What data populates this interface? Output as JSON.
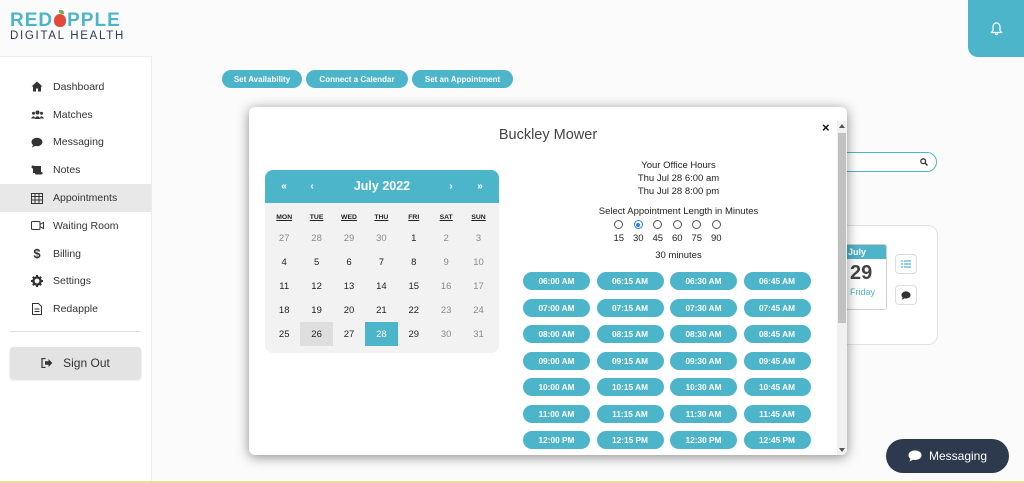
{
  "logo": {
    "top_pre": "RED",
    "top_post": "PPLE",
    "bottom": "DIGITAL HEALTH"
  },
  "sidebar": {
    "items": [
      {
        "label": "Dashboard",
        "icon": "home-icon"
      },
      {
        "label": "Matches",
        "icon": "users-icon"
      },
      {
        "label": "Messaging",
        "icon": "chat-icon"
      },
      {
        "label": "Notes",
        "icon": "scroll-icon"
      },
      {
        "label": "Appointments",
        "icon": "table-icon",
        "active": true
      },
      {
        "label": "Waiting Room",
        "icon": "video-icon"
      },
      {
        "label": "Billing",
        "icon": "dollar-icon"
      },
      {
        "label": "Settings",
        "icon": "gear-icon"
      },
      {
        "label": "Redapple",
        "icon": "document-icon"
      }
    ],
    "signout_label": "Sign Out"
  },
  "toolbar": {
    "set_availability": "Set Availability",
    "connect_calendar": "Connect a Calendar",
    "set_appointment": "Set an Appointment"
  },
  "background_card": {
    "month": "July",
    "day": "29",
    "weekday": "Friday"
  },
  "modal": {
    "title": "Buckley Mower",
    "close_label": "×",
    "calendar": {
      "prev_year": "«",
      "prev_month": "‹",
      "month_label": "July 2022",
      "next_month": "›",
      "next_year": "»",
      "dows": [
        "MON",
        "TUE",
        "WED",
        "THU",
        "FRI",
        "SAT",
        "SUN"
      ],
      "weeks": [
        [
          "27",
          "28",
          "29",
          "30",
          "1",
          "2",
          "3"
        ],
        [
          "4",
          "5",
          "6",
          "7",
          "8",
          "9",
          "10"
        ],
        [
          "11",
          "12",
          "13",
          "14",
          "15",
          "16",
          "17"
        ],
        [
          "18",
          "19",
          "20",
          "21",
          "22",
          "23",
          "24"
        ],
        [
          "25",
          "26",
          "27",
          "28",
          "29",
          "30",
          "31"
        ]
      ]
    },
    "office_hours_title": "Your Office Hours",
    "office_hours_start": "Thu Jul 28 6:00 am",
    "office_hours_end": "Thu Jul 28 8:00 pm",
    "length_label": "Select Appointment Length in Minutes",
    "length_options": [
      "15",
      "30",
      "45",
      "60",
      "75",
      "90"
    ],
    "length_selected": "30",
    "length_selected_text": "30 minutes",
    "slots": [
      "06:00 AM",
      "06:15 AM",
      "06:30 AM",
      "06:45 AM",
      "07:00 AM",
      "07:15 AM",
      "07:30 AM",
      "07:45 AM",
      "08:00 AM",
      "08:15 AM",
      "08:30 AM",
      "08:45 AM",
      "09:00 AM",
      "09:15 AM",
      "09:30 AM",
      "09:45 AM",
      "10:00 AM",
      "10:15 AM",
      "10:30 AM",
      "10:45 AM",
      "11:00 AM",
      "11:15 AM",
      "11:30 AM",
      "11:45 AM",
      "12:00 PM",
      "12:15 PM",
      "12:30 PM",
      "12:45 PM"
    ]
  },
  "messaging_button": "Messaging",
  "colors": {
    "accent": "#4db5c9",
    "brand_red": "#e4483c",
    "navy": "#2f3a56",
    "messaging_bg": "#2d3a4d"
  }
}
